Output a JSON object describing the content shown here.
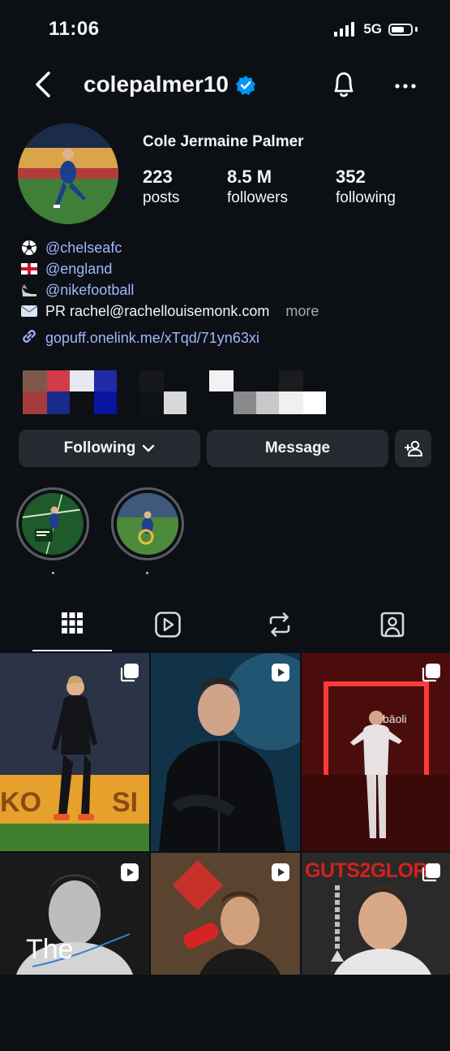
{
  "status_bar": {
    "time": "11:06",
    "network": "5G"
  },
  "header": {
    "username": "colepalmer10"
  },
  "profile": {
    "full_name": "Cole Jermaine Palmer",
    "stats": [
      {
        "value": "223",
        "label": "posts"
      },
      {
        "value": "8.5 M",
        "label": "followers"
      },
      {
        "value": "352",
        "label": "following"
      }
    ]
  },
  "bio": {
    "lines": [
      {
        "emoji": "⚽",
        "text": "@chelseafc"
      },
      {
        "emoji": "🏴",
        "text": "@england"
      },
      {
        "emoji": "👟",
        "text": "@nikefootball"
      }
    ],
    "pr_label": "PR rachel@rachellouisemonk.com",
    "more_label": "more",
    "link": "gopuff.onelink.me/xTqd/71yn63xi"
  },
  "actions": {
    "following_label": "Following",
    "message_label": "Message"
  },
  "highlights": [
    {
      "title": "."
    },
    {
      "title": "."
    }
  ],
  "tabs": [
    {
      "icon": "grid-icon",
      "active": true
    },
    {
      "icon": "reels-icon",
      "active": false
    },
    {
      "icon": "reposts-icon",
      "active": false
    },
    {
      "icon": "tagged-icon",
      "active": false
    }
  ],
  "posts": [
    {
      "badge": "carousel-icon"
    },
    {
      "badge": "reel-icon"
    },
    {
      "badge": "carousel-icon"
    },
    {
      "badge": "reel-icon",
      "overlay_text": "The"
    },
    {
      "badge": "reel-icon"
    },
    {
      "badge": "carousel-icon",
      "overlay_text": "GUTS2GLORY"
    }
  ],
  "colors": {
    "background": "#0c1014",
    "link": "#a3b5ff",
    "verified": "#0095f6",
    "button": "#262a30"
  }
}
